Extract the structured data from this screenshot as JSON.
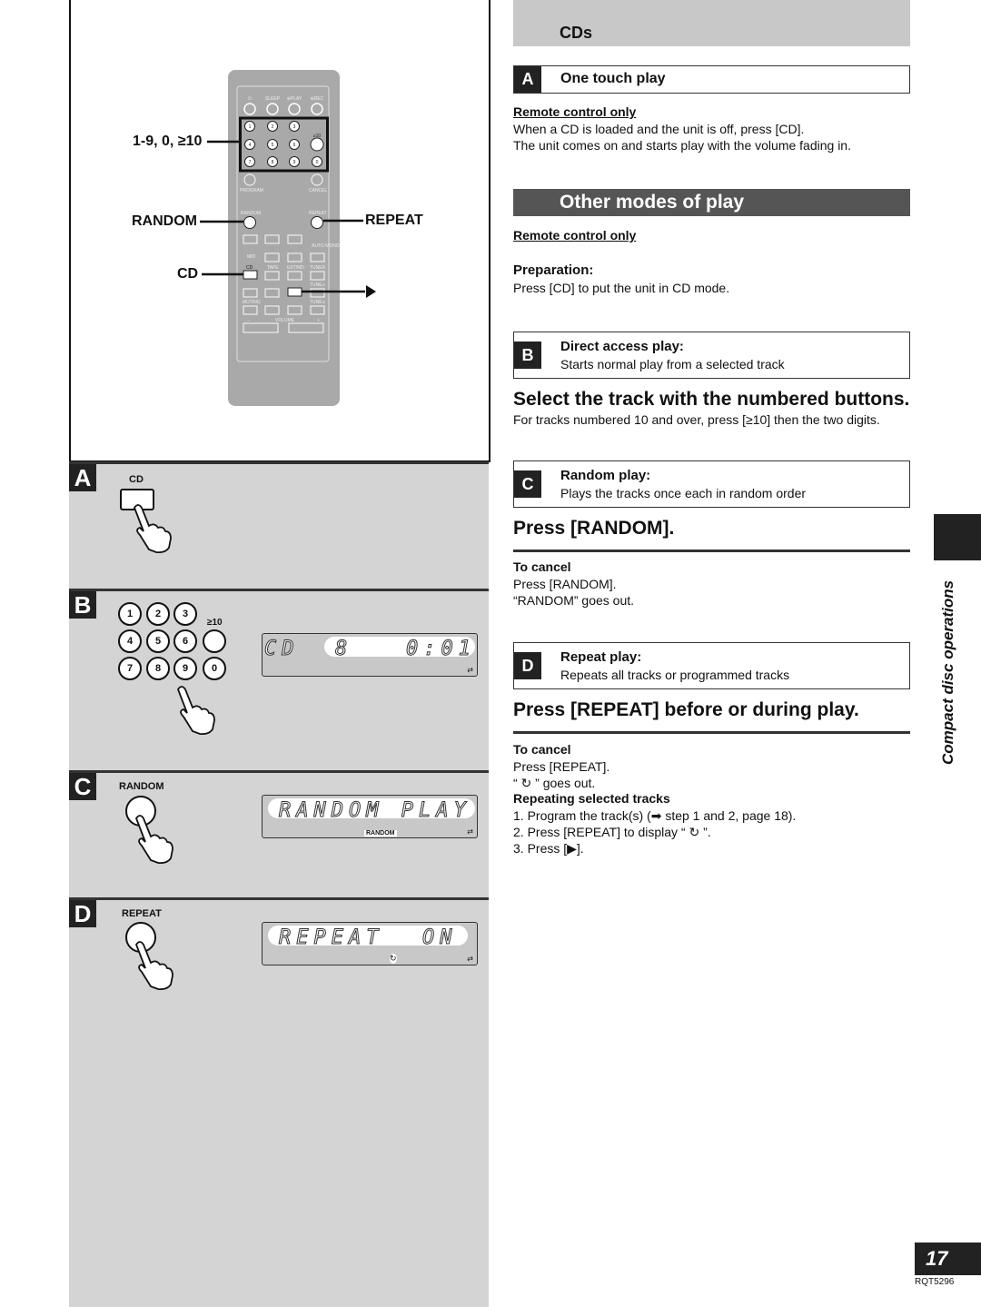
{
  "left": {
    "callouts": {
      "numbers": "1-9, 0, ≥10",
      "random": "RANDOM",
      "repeat": "REPEAT",
      "cd": "CD",
      "play_arrow": "▶"
    },
    "remote": {
      "top_row": [
        "⏻",
        "SLEEP",
        "⊕PLAY",
        "⊕REC"
      ],
      "digits": [
        "1",
        "2",
        "3",
        "",
        "4",
        "5",
        "6",
        "≥10",
        "7",
        "8",
        "9",
        "0"
      ],
      "program": "PROGRAM",
      "cancel": "CANCEL",
      "random": "RANDOM",
      "repeat": "REPEAT",
      "mid": "MID",
      "auto_mono": "AUTO MONO",
      "cd": "CD",
      "tape": "TAPE",
      "ext_md": "EXT/MD",
      "tuner": "TUNER",
      "muting": "MUTING",
      "tune_up": "TUNE∧",
      "tune_down": "TUNE∨",
      "volume": "VOLUME",
      "vol_minus": "−",
      "vol_plus": "+"
    },
    "sections": [
      {
        "letter": "A",
        "label": "CD"
      },
      {
        "letter": "B",
        "keys": [
          "1",
          "2",
          "3",
          "4",
          "5",
          "6",
          "7",
          "8",
          "9",
          "0"
        ],
        "key10": "≥10",
        "display": {
          "left": "CD",
          "track": "8",
          "time": "0:01",
          "indicator": "⇄"
        }
      },
      {
        "letter": "C",
        "label": "RANDOM",
        "display": {
          "text": "RANDOM PLAY",
          "indicator_label": "RANDOM",
          "indicator": "⇄"
        }
      },
      {
        "letter": "D",
        "label": "REPEAT",
        "display": {
          "text": "REPEAT",
          "state": "ON",
          "repeat_icon": "↻",
          "indicator": "⇄"
        }
      }
    ]
  },
  "right": {
    "header": "CDs",
    "one_touch": {
      "letter": "A",
      "title": "One touch play",
      "sub": "Remote control only",
      "lines": [
        "When a CD is loaded and the unit is off, press [CD].",
        "The unit comes on and starts play with the volume fading in."
      ]
    },
    "other_modes": {
      "title": "Other modes of play",
      "sub": "Remote control only",
      "prep_title": "Preparation:",
      "prep_text": "Press [CD] to put the unit in CD mode."
    },
    "direct": {
      "letter": "B",
      "title": "Direct access play:",
      "desc": "Starts normal play from a selected track",
      "heading": "Select the track with the numbered buttons.",
      "note": "For tracks numbered 10 and over, press [≥10] then the two digits."
    },
    "random": {
      "letter": "C",
      "title": "Random play:",
      "desc": "Plays the tracks once each in random order",
      "heading": "Press [RANDOM].",
      "cancel_title": "To cancel",
      "cancel_lines": [
        "Press [RANDOM].",
        "“RANDOM” goes out."
      ]
    },
    "repeat": {
      "letter": "D",
      "title": "Repeat play:",
      "desc": "Repeats all tracks or programmed tracks",
      "heading": "Press [REPEAT] before or during play.",
      "cancel_title": "To cancel",
      "cancel_lines": [
        "Press [REPEAT].",
        "“ ↻ ” goes out."
      ],
      "sel_title": "Repeating selected tracks",
      "steps": [
        "1.  Program the track(s) (➡ step 1 and 2, page 18).",
        "2.  Press [REPEAT] to display “ ↻ ”.",
        "3.  Press [▶]."
      ]
    }
  },
  "side_tab": "Compact disc operations",
  "page_number": "17",
  "doc_code": "RQT5296"
}
